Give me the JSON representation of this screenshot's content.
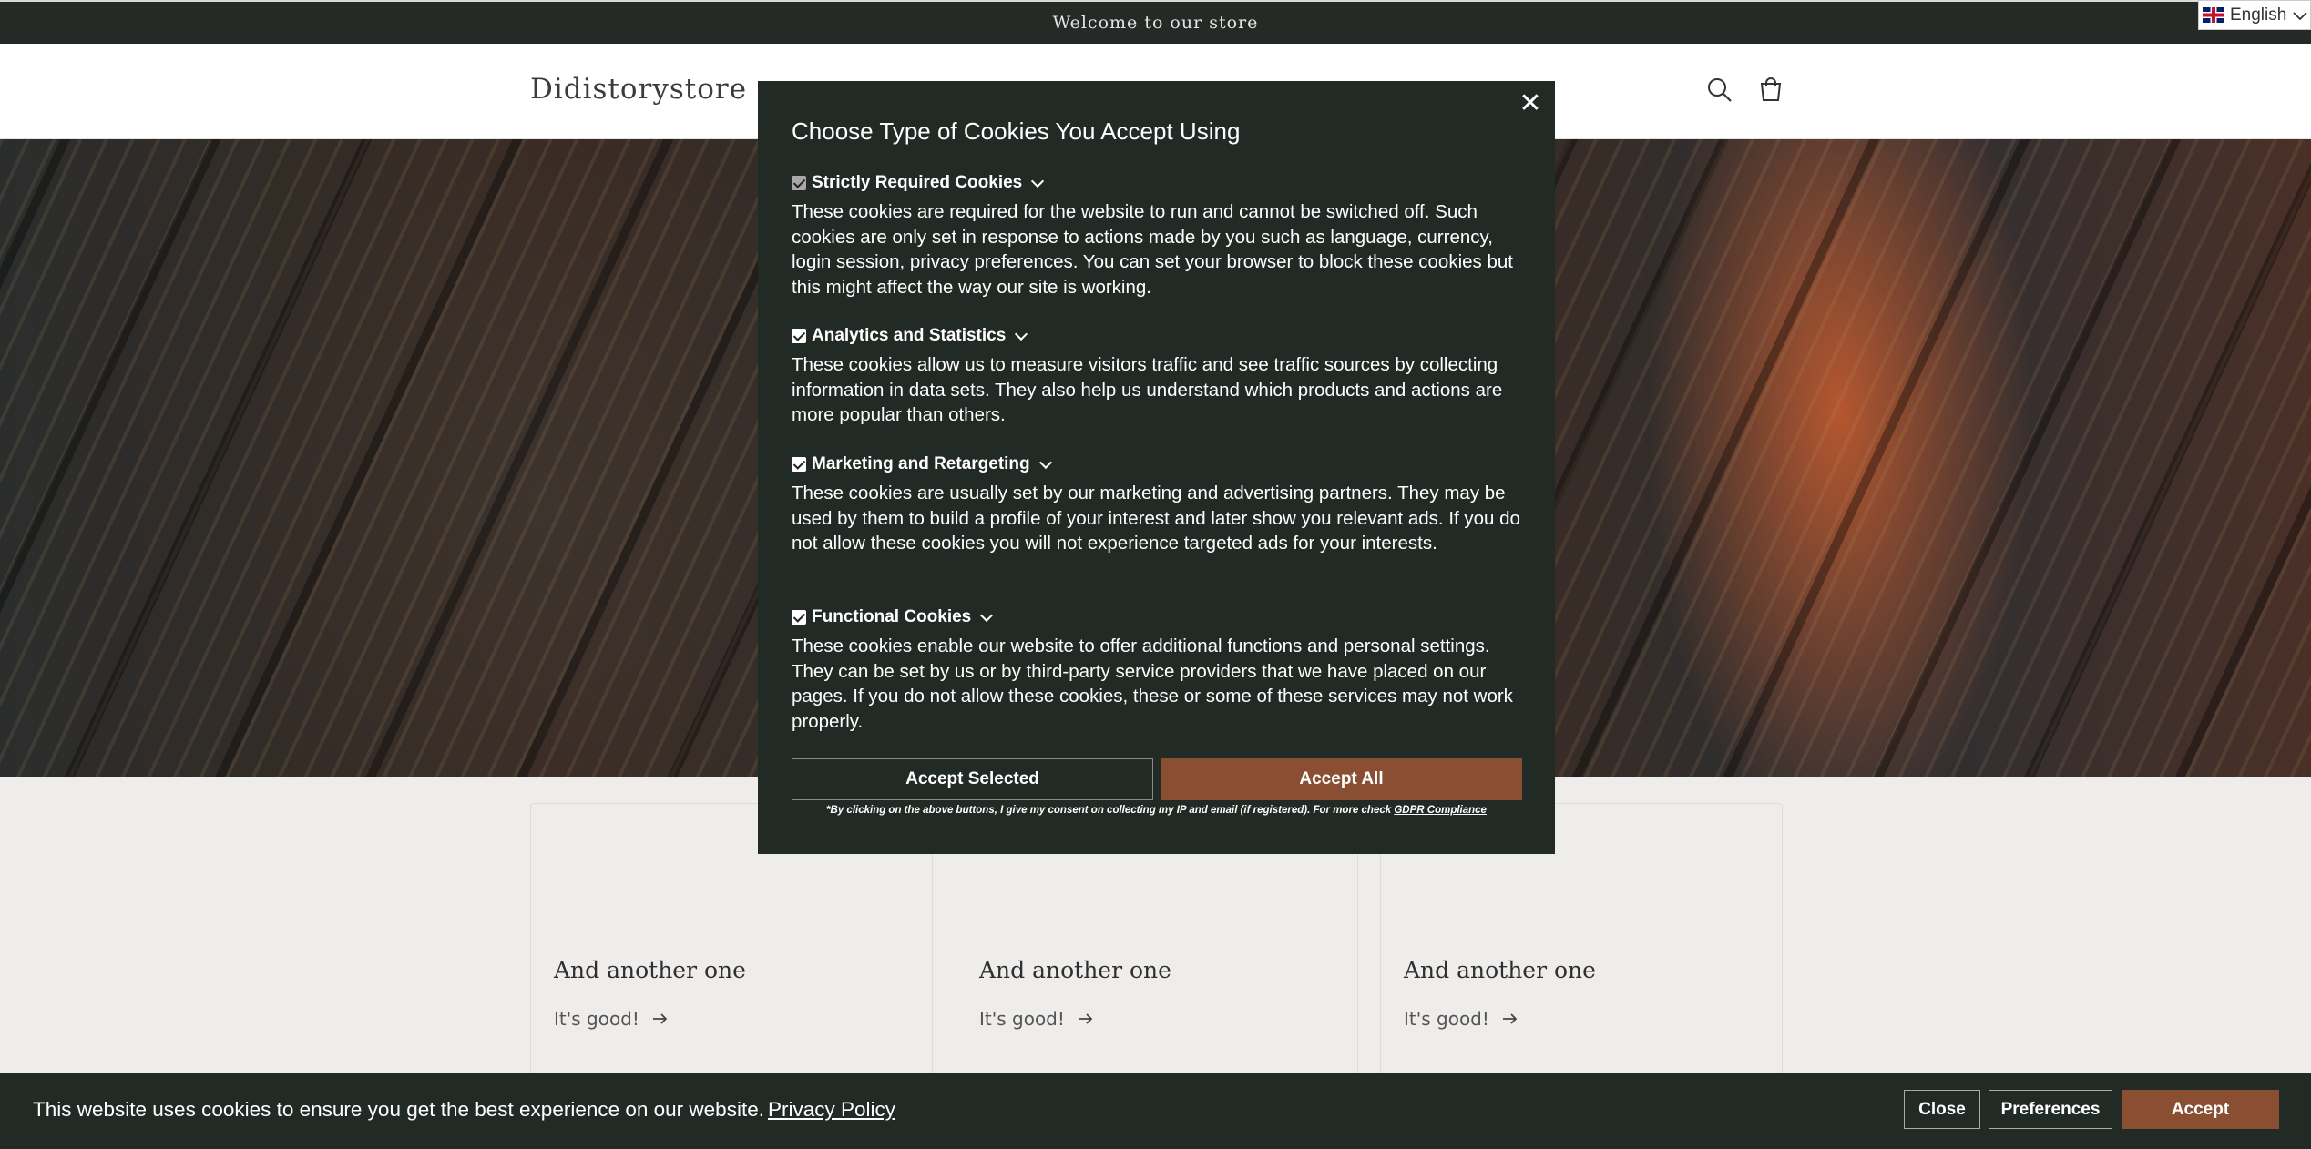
{
  "announcement": {
    "text": "Welcome to our store"
  },
  "language": {
    "label": "English"
  },
  "header": {
    "logo": "Didistorystore"
  },
  "cards": [
    {
      "title": "And another one",
      "link": "It's good!"
    },
    {
      "title": "And another one",
      "link": "It's good!"
    },
    {
      "title": "And another one",
      "link": "It's good!"
    }
  ],
  "modal": {
    "title": "Choose Type of Cookies You Accept Using",
    "sections": [
      {
        "label": "Strictly Required Cookies",
        "checked": true,
        "disabled": true,
        "text": "These cookies are required for the website to run and cannot be switched off. Such cookies are only set in response to actions made by you such as language, currency, login session, privacy preferences. You can set your browser to block these cookies but this might affect the way our site is working."
      },
      {
        "label": "Analytics and Statistics",
        "checked": true,
        "text": "These cookies allow us to measure visitors traffic and see traffic sources by collecting information in data sets. They also help us understand which products and actions are more popular than others."
      },
      {
        "label": "Marketing and Retargeting",
        "checked": true,
        "text": "These cookies are usually set by our marketing and advertising partners. They may be used by them to build a profile of your interest and later show you relevant ads. If you do not allow these cookies you will not experience targeted ads for your interests."
      },
      {
        "label": "Functional Cookies",
        "checked": true,
        "text": "These cookies enable our website to offer additional functions and personal settings. They can be set by us or by third-party service providers that we have placed on our pages. If you do not allow these cookies, these or some of these services may not work properly."
      }
    ],
    "accept_selected": "Accept Selected",
    "accept_all": "Accept All",
    "consent_text": "*By clicking on the above buttons, I give my consent on collecting my IP and email (if registered). For more check",
    "consent_link": "GDPR Compliance",
    "close_glyph": "✕"
  },
  "cookie_bar": {
    "text": "This website uses cookies to ensure you get the best experience on our website.",
    "link": "Privacy Policy",
    "close": "Close",
    "preferences": "Preferences",
    "accept": "Accept"
  },
  "colors": {
    "dark": "#222a26",
    "accent": "#8a4f33"
  }
}
